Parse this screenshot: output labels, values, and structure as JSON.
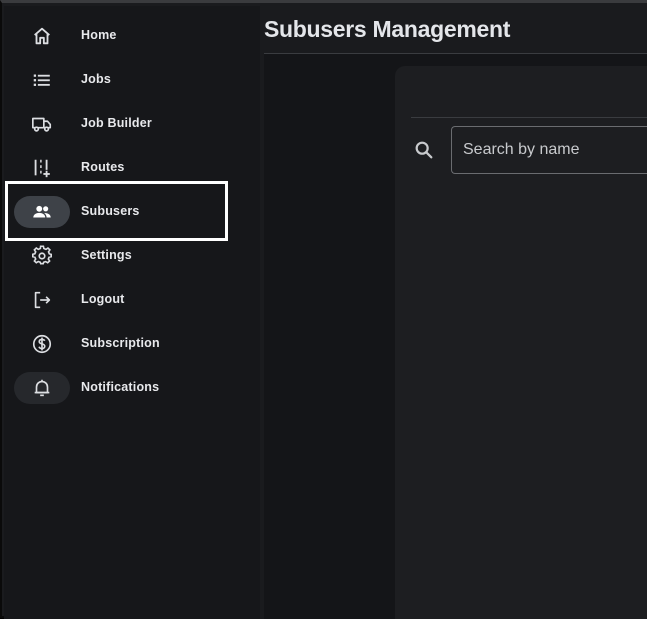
{
  "sidebar": {
    "items": [
      {
        "label": "Home",
        "icon": "home-icon"
      },
      {
        "label": "Jobs",
        "icon": "list-icon"
      },
      {
        "label": "Job Builder",
        "icon": "truck-icon"
      },
      {
        "label": "Routes",
        "icon": "routes-icon"
      },
      {
        "label": "Subusers",
        "icon": "people-icon",
        "active": true
      },
      {
        "label": "Settings",
        "icon": "gear-icon"
      },
      {
        "label": "Logout",
        "icon": "logout-icon"
      },
      {
        "label": "Subscription",
        "icon": "dollar-circle-icon"
      },
      {
        "label": "Notifications",
        "icon": "bell-icon"
      }
    ]
  },
  "main": {
    "title": "Subusers Management",
    "search": {
      "placeholder": "Search by name",
      "value": ""
    }
  },
  "colors": {
    "sidebar_bg": "#16171a",
    "main_bg": "#1a1b1e",
    "active_pill": "#3e4248",
    "text": "#e8e9ec",
    "highlight": "#ffffff"
  }
}
